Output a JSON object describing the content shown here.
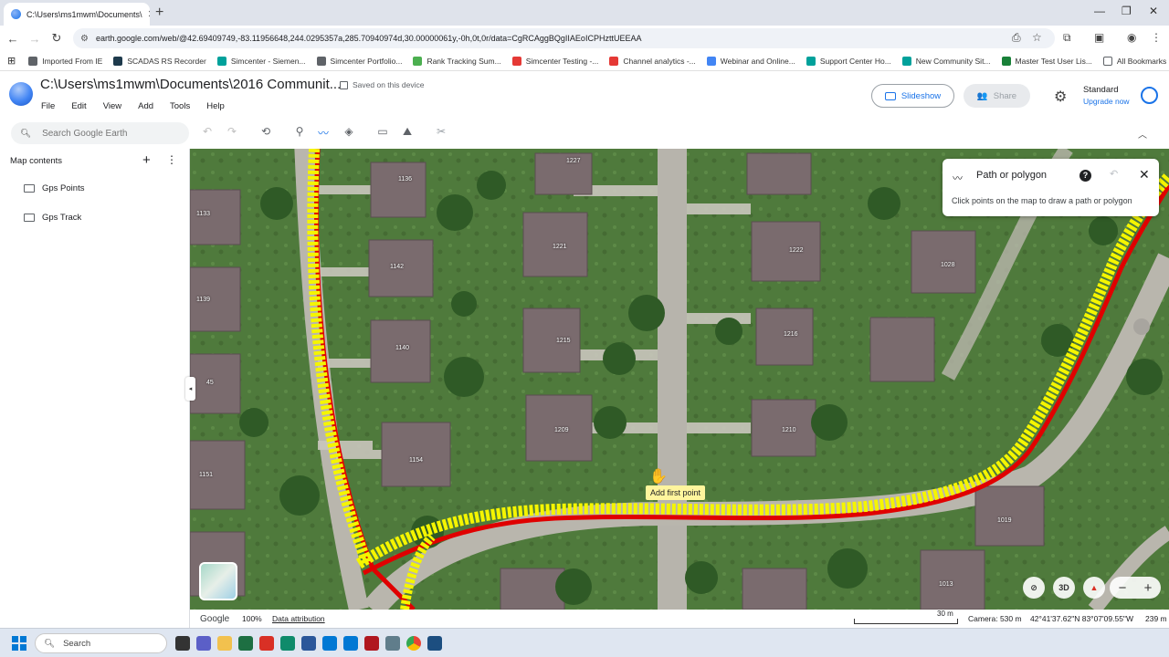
{
  "browser": {
    "tab_title": "C:\\Users\\ms1mwm\\Documents\\",
    "url": "earth.google.com/web/@42.69409749,-83.11956648,244.0295357a,285.70940974d,30.00000061y,-0h,0t,0r/data=CgRCAggBQgIIAEoICPHzttUEEAA",
    "bookmarks": [
      {
        "label": "Imported From IE",
        "color": "#5f6368"
      },
      {
        "label": "SCADAS RS Recorder",
        "color": "#1e3a4c"
      },
      {
        "label": "Simcenter - Siemen...",
        "color": "#00a19b"
      },
      {
        "label": "Simcenter Portfolio...",
        "color": "#5f6368"
      },
      {
        "label": "Rank Tracking Sum...",
        "color": "#4caf50"
      },
      {
        "label": "Simcenter Testing -...",
        "color": "#e53935"
      },
      {
        "label": "Channel analytics -...",
        "color": "#e53935"
      },
      {
        "label": "Webinar and Online...",
        "color": "#4285f4"
      },
      {
        "label": "Support Center Ho...",
        "color": "#00a19b"
      },
      {
        "label": "New Community Sit...",
        "color": "#00a19b"
      },
      {
        "label": "Master Test User Lis...",
        "color": "#188038"
      }
    ],
    "all_bookmarks": "All Bookmarks"
  },
  "header": {
    "doc_title": "C:\\Users\\ms1mwm\\Documents\\2016 Communit...",
    "saved_status": "Saved on this device",
    "menu": [
      "File",
      "Edit",
      "View",
      "Add",
      "Tools",
      "Help"
    ],
    "slideshow_label": "Slideshow",
    "share_label": "Share",
    "plan_label": "Standard",
    "upgrade_label": "Upgrade now"
  },
  "toolbar": {
    "search_placeholder": "Search Google Earth"
  },
  "sidebar": {
    "title": "Map contents",
    "items": [
      {
        "label": "Gps Points"
      },
      {
        "label": "Gps Track"
      }
    ]
  },
  "map": {
    "house_labels": [
      "1136",
      "1227",
      "1133",
      "1221",
      "1142",
      "1222",
      "1028",
      "1139",
      "1215",
      "1216",
      "1140",
      "45",
      "1209",
      "1210",
      "1154",
      "1151",
      "1019",
      "1013"
    ],
    "cursor_tooltip": "Add first point",
    "view_mode": "3D"
  },
  "path_panel": {
    "title": "Path or polygon",
    "description": "Click points on the map to draw a path or polygon"
  },
  "status": {
    "logo": "Google",
    "zoom": "100%",
    "attribution": "Data attribution",
    "scale": "30 m",
    "camera": "Camera: 530 m",
    "coordinates": "42°41'37.62\"N 83°07'09.55\"W",
    "altitude": "239 m"
  },
  "taskbar": {
    "search_label": "Search",
    "apps": [
      "explorer",
      "teams",
      "file-explorer",
      "excel",
      "acrobat",
      "edge",
      "notepad",
      "outlook",
      "outlook-2",
      "filezilla",
      "settings",
      "chrome",
      "teamlink"
    ]
  },
  "colors": {
    "accent": "#1a73e8",
    "track_yellow": "#f5f500",
    "track_red": "#e00000"
  }
}
